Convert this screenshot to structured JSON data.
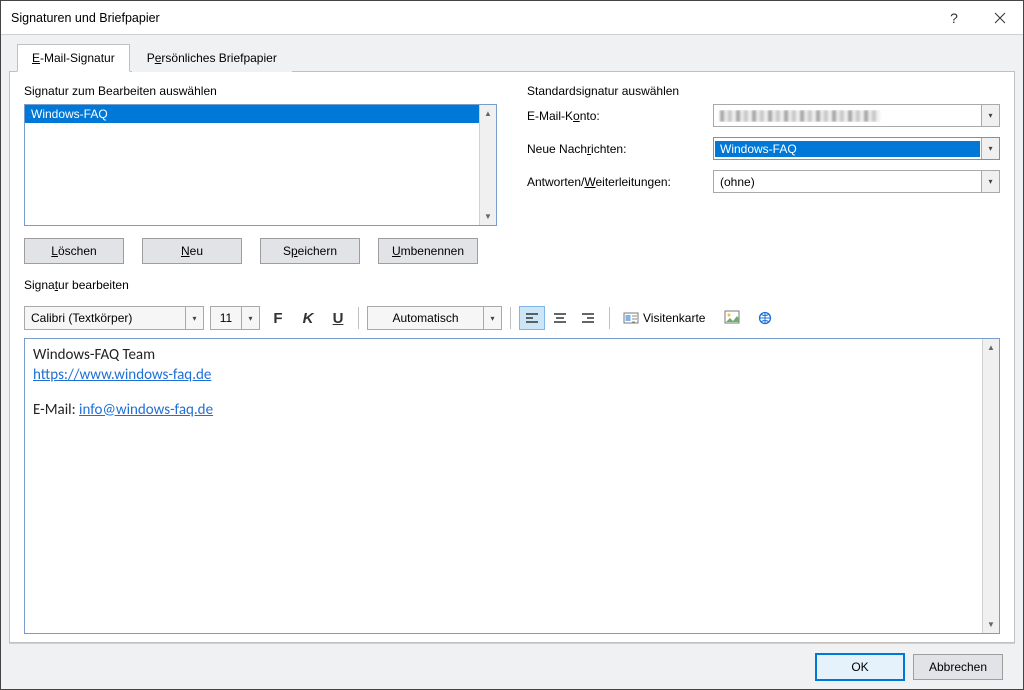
{
  "window": {
    "title": "Signaturen und Briefpapier"
  },
  "tabs": {
    "email": "E-Mail-Signatur",
    "stationery": "Persönliches Briefpapier"
  },
  "left": {
    "heading": "Signatur zum Bearbeiten auswählen",
    "items": [
      "Windows-FAQ"
    ],
    "btn_delete": "Löschen",
    "btn_new": "Neu",
    "btn_save": "Speichern",
    "btn_rename": "Umbenennen"
  },
  "right": {
    "heading": "Standardsignatur auswählen",
    "lbl_account": "E-Mail-Konto:",
    "lbl_new": "Neue Nachrichten:",
    "val_new": "Windows-FAQ",
    "lbl_reply": "Antworten/Weiterleitungen:",
    "val_reply": "(ohne)"
  },
  "editsec": {
    "heading": "Signatur bearbeiten"
  },
  "toolbar": {
    "font": "Calibri (Textkörper)",
    "size": "11",
    "bold": "F",
    "italic": "K",
    "underline": "U",
    "color": "Automatisch",
    "bizcard": "Visitenkarte"
  },
  "editor": {
    "line1": "Windows-FAQ Team",
    "url": "https://www.windows-faq.de",
    "email_prefix": "E-Mail: ",
    "email": "info@windows-faq.de"
  },
  "footer": {
    "ok": "OK",
    "cancel": "Abbrechen"
  }
}
